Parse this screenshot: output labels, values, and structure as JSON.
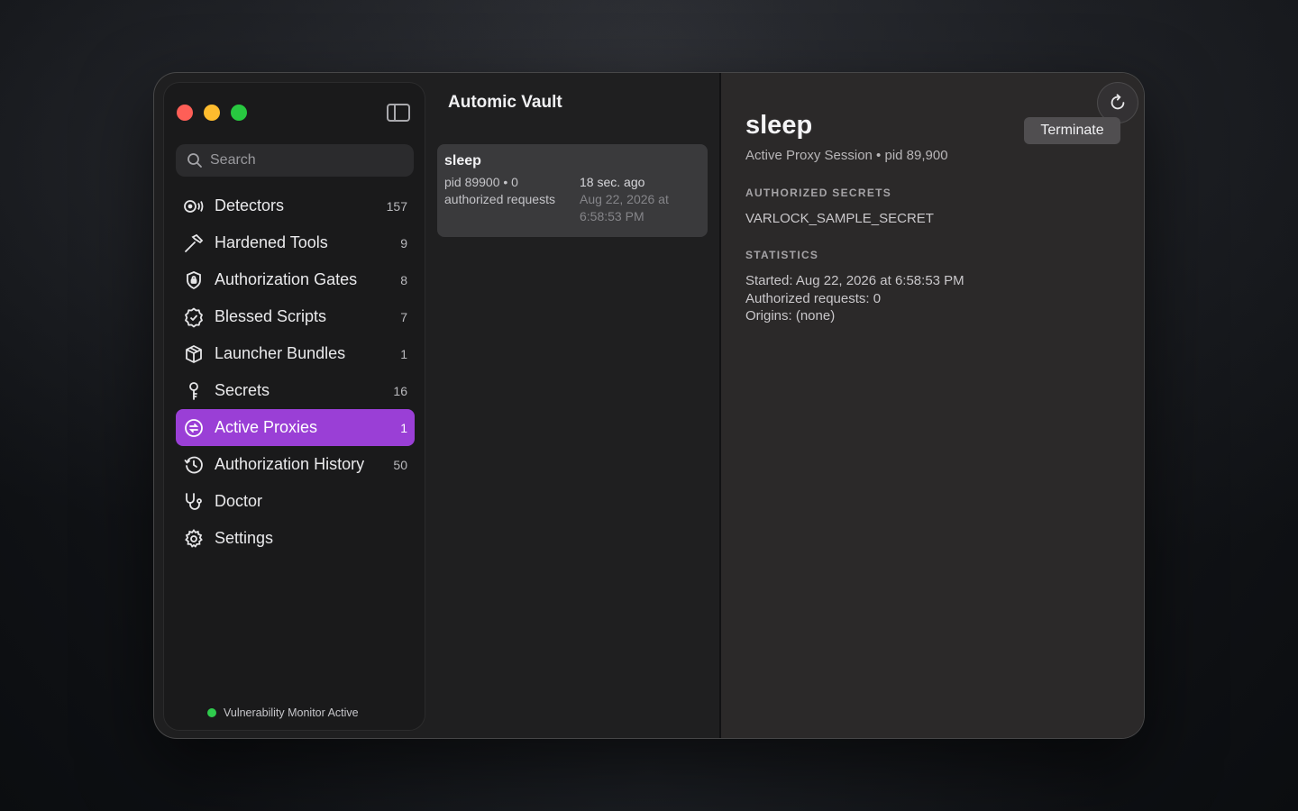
{
  "window": {
    "traffic_lights": [
      "close",
      "minimize",
      "zoom"
    ]
  },
  "sidebar": {
    "search_placeholder": "Search",
    "items": [
      {
        "label": "Detectors",
        "count": "157",
        "icon": "detector-icon",
        "active": false
      },
      {
        "label": "Hardened Tools",
        "count": "9",
        "icon": "hammer-icon",
        "active": false
      },
      {
        "label": "Authorization Gates",
        "count": "8",
        "icon": "shield-lock-icon",
        "active": false
      },
      {
        "label": "Blessed Scripts",
        "count": "7",
        "icon": "checkmark-seal-icon",
        "active": false
      },
      {
        "label": "Launcher Bundles",
        "count": "1",
        "icon": "cube-icon",
        "active": false
      },
      {
        "label": "Secrets",
        "count": "16",
        "icon": "key-icon",
        "active": false
      },
      {
        "label": "Active Proxies",
        "count": "1",
        "icon": "proxy-arrows-icon",
        "active": true
      },
      {
        "label": "Authorization History",
        "count": "50",
        "icon": "clock-history-icon",
        "active": false
      },
      {
        "label": "Doctor",
        "count": "",
        "icon": "stethoscope-icon",
        "active": false
      },
      {
        "label": "Settings",
        "count": "",
        "icon": "gear-icon",
        "active": false
      }
    ],
    "status": "Vulnerability Monitor Active",
    "active_color": "#9a3fd6",
    "status_color": "#2fcb4d"
  },
  "list": {
    "title": "Automic Vault",
    "cards": [
      {
        "title": "sleep",
        "meta": "pid 89900 • 0 authorized requests",
        "ago": "18 sec. ago",
        "date": "Aug 22, 2026 at 6:58:53 PM"
      }
    ]
  },
  "detail": {
    "title": "sleep",
    "subtitle": "Active Proxy Session • pid 89,900",
    "terminate_label": "Terminate",
    "refresh_icon": "refresh-icon",
    "secrets_heading": "AUTHORIZED SECRETS",
    "secret_name": "VARLOCK_SAMPLE_SECRET",
    "stats_heading": "STATISTICS",
    "stats": [
      "Started: Aug 22, 2026 at 6:58:53 PM",
      "Authorized requests: 0",
      "Origins: (none)"
    ]
  }
}
